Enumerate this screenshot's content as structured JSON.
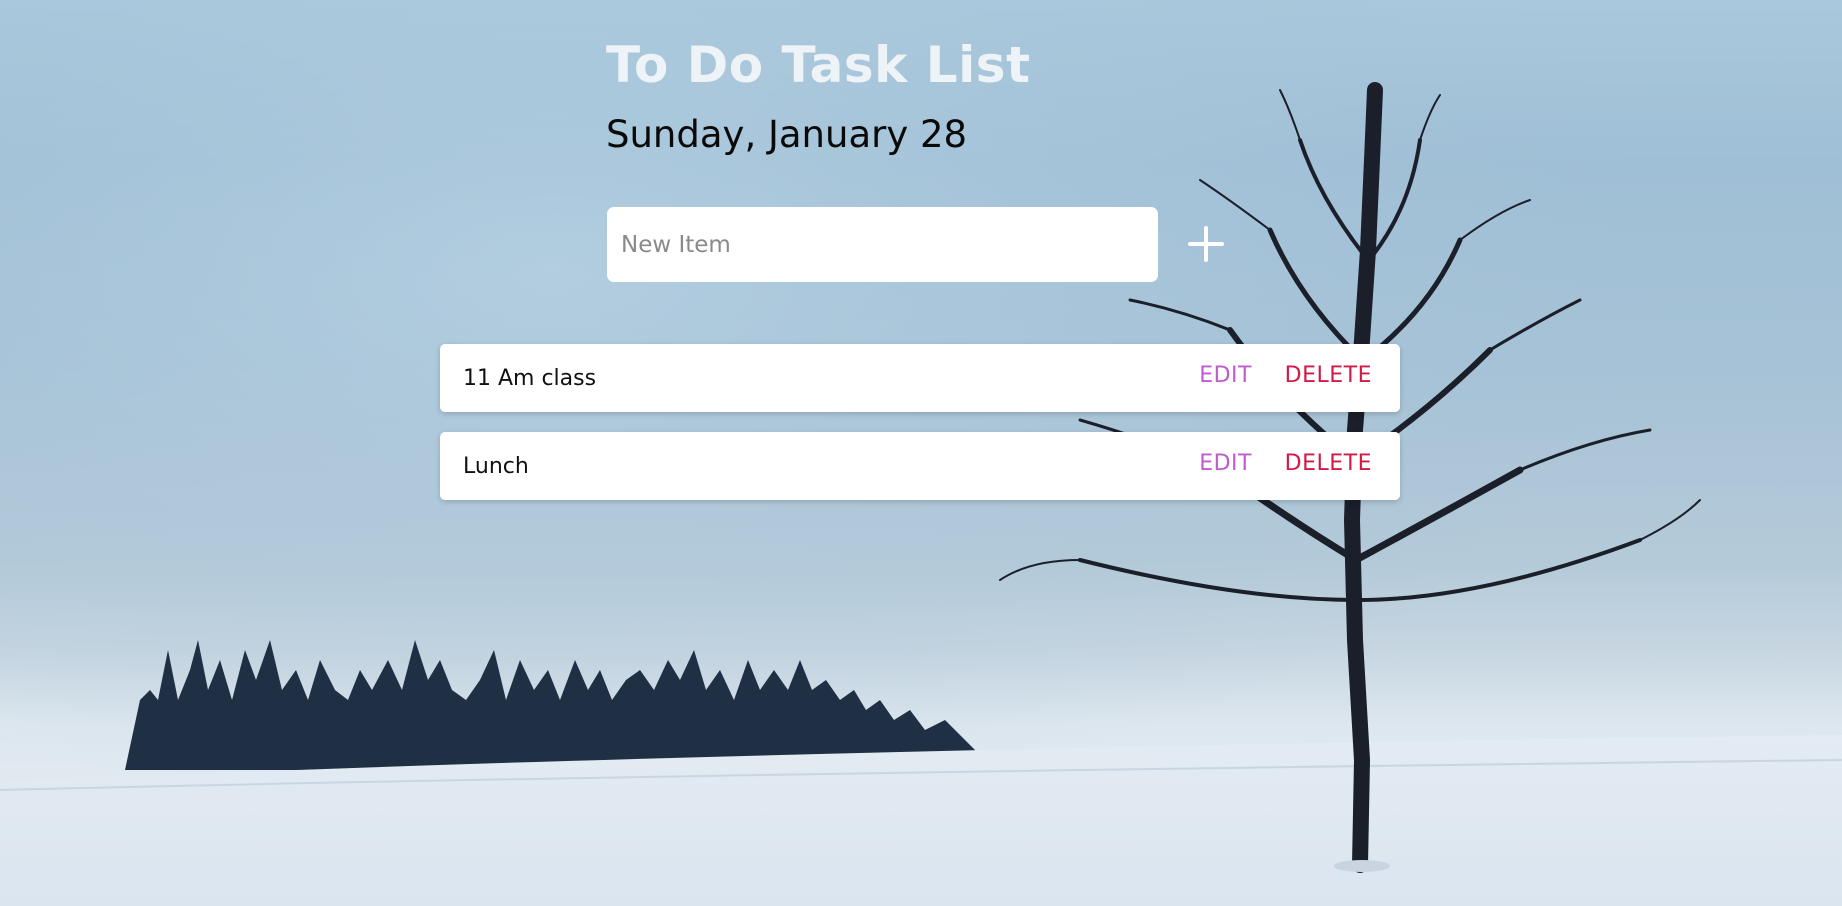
{
  "app": {
    "title": "To Do Task List",
    "date": "Sunday, January 28"
  },
  "new_item": {
    "placeholder": "New Item",
    "value": "",
    "add_icon": "plus-icon"
  },
  "tasks": [
    {
      "text": "11 Am class",
      "edit_label": "EDIT",
      "delete_label": "DELETE"
    },
    {
      "text": "Lunch",
      "edit_label": "EDIT",
      "delete_label": "DELETE"
    }
  ],
  "colors": {
    "title": "#eef3f8",
    "edit": "#c05bd0",
    "delete": "#d21a47",
    "card": "#ffffff"
  }
}
